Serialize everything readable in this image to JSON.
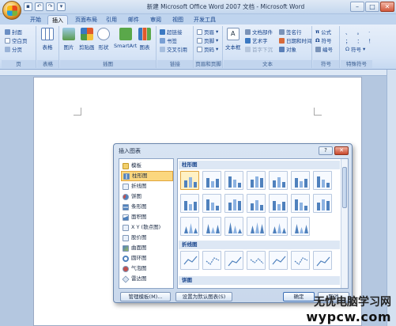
{
  "window": {
    "title": "新建 Microsoft Office Word 2007 文档 - Microsoft Word",
    "minimize": "–",
    "maximize": "□",
    "close": "✕"
  },
  "tabs": [
    "开始",
    "插入",
    "页面布局",
    "引用",
    "邮件",
    "审阅",
    "视图",
    "开发工具"
  ],
  "active_tab": "插入",
  "ribbon": {
    "pages": {
      "label": "页",
      "items": [
        "封面",
        "空白页",
        "分页"
      ]
    },
    "tables": {
      "label": "表格",
      "button": "表格"
    },
    "illustrations": {
      "label": "插图",
      "buttons": [
        "图片",
        "剪贴画",
        "形状",
        "SmartArt",
        "图表"
      ]
    },
    "links": {
      "label": "链接",
      "items": [
        "超链接",
        "书签",
        "交叉引用"
      ]
    },
    "header_footer": {
      "label": "页眉和页脚",
      "items": [
        "页眉",
        "页脚",
        "页码"
      ]
    },
    "text": {
      "label": "文本",
      "textbox": "文本框",
      "items": [
        "文档部件",
        "艺术字",
        "首字下沉",
        "签名行",
        "日期和时间",
        "对象"
      ]
    },
    "symbols": {
      "label": "符号",
      "items": [
        "公式",
        "符号",
        "编号"
      ]
    },
    "special": {
      "label": "特殊符号",
      "items": [
        "符号"
      ]
    }
  },
  "dialog": {
    "title": "插入图表",
    "help": "?",
    "close": "✕",
    "categories": [
      {
        "label": "模板",
        "icon": "folder-icon"
      },
      {
        "label": "柱形图",
        "icon": "column-chart-icon"
      },
      {
        "label": "折线图",
        "icon": "line-chart-icon"
      },
      {
        "label": "饼图",
        "icon": "pie-chart-icon"
      },
      {
        "label": "条形图",
        "icon": "bar-chart-icon"
      },
      {
        "label": "面积图",
        "icon": "area-chart-icon"
      },
      {
        "label": "X Y (散点图)",
        "icon": "scatter-chart-icon"
      },
      {
        "label": "股价图",
        "icon": "stock-chart-icon"
      },
      {
        "label": "曲面图",
        "icon": "surface-chart-icon"
      },
      {
        "label": "圆环图",
        "icon": "doughnut-chart-icon"
      },
      {
        "label": "气泡图",
        "icon": "bubble-chart-icon"
      },
      {
        "label": "雷达图",
        "icon": "radar-chart-icon"
      }
    ],
    "selected_category": "柱形图",
    "sections": [
      "柱形图",
      "折线图",
      "饼图"
    ],
    "buttons": {
      "manage": "管理模板(M)...",
      "set_default": "设置为默认图表(S)",
      "ok": "确定",
      "cancel": "取消"
    }
  },
  "watermark": {
    "line1": "无忧电脑学习网",
    "line2": "wypcw.com"
  },
  "colors": {
    "accent": "#15428b",
    "selected": "#fbd77f",
    "chart_blue": "#4f81bd"
  }
}
